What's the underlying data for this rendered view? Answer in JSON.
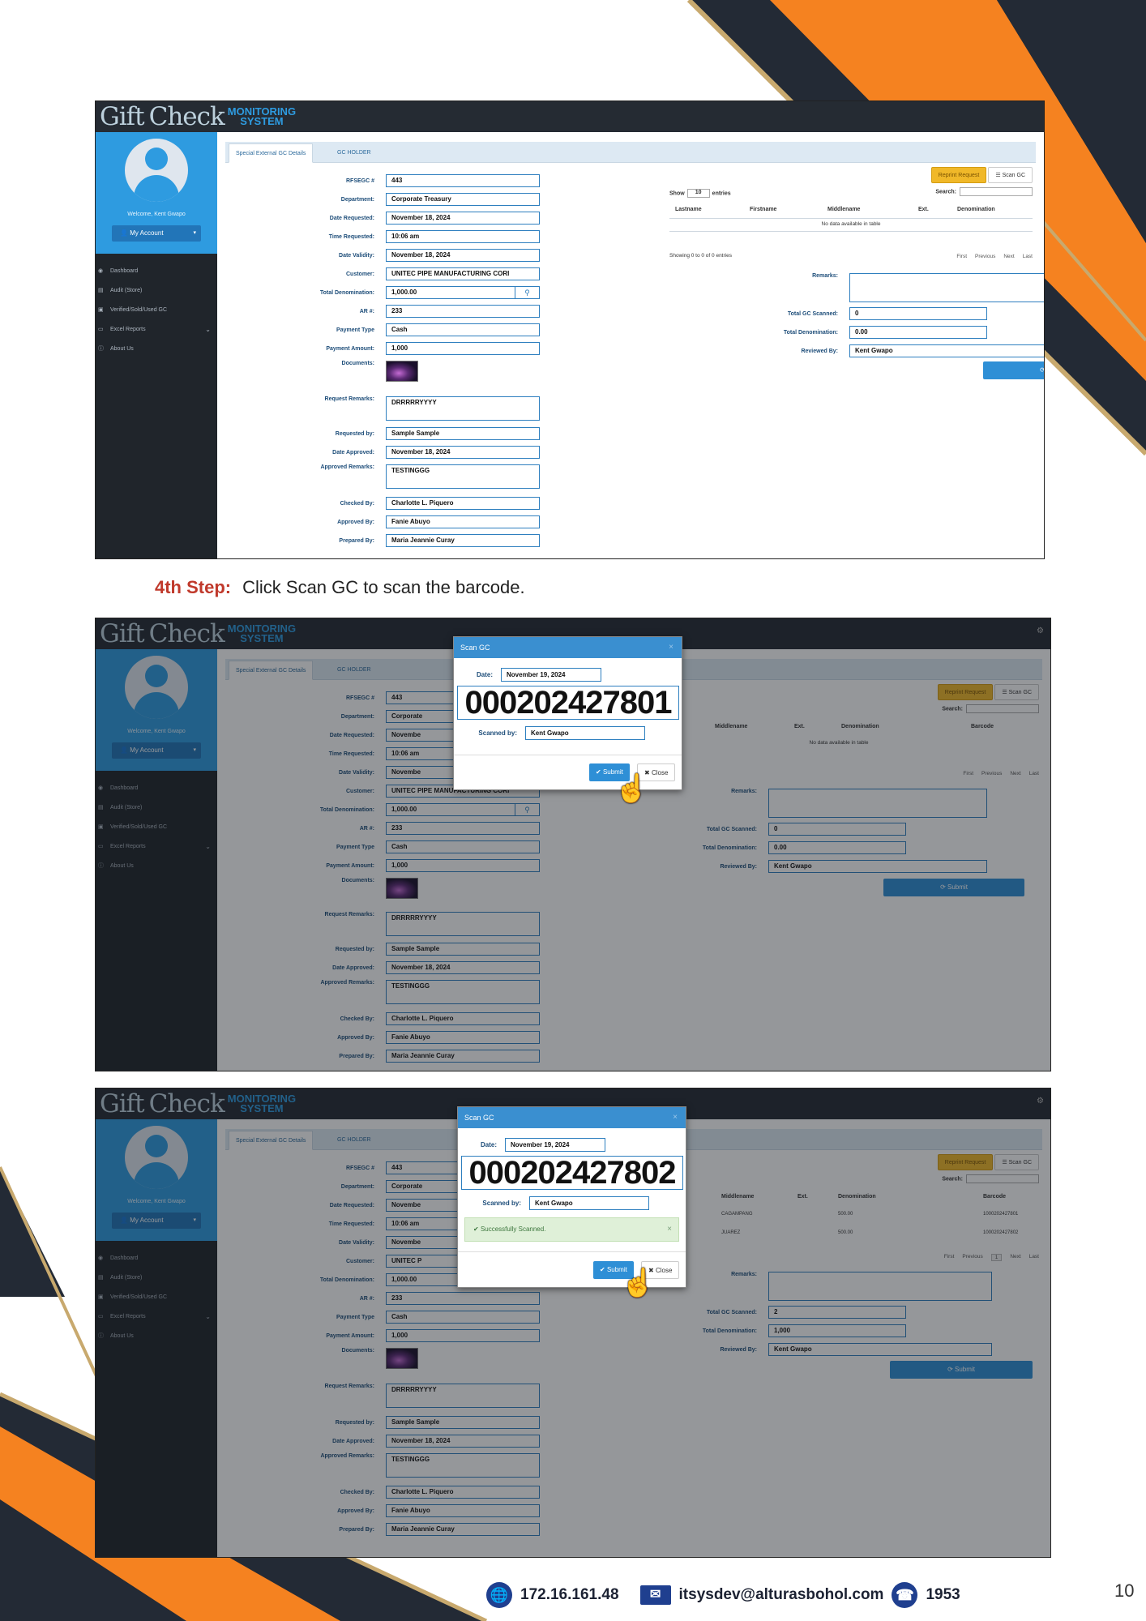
{
  "app": {
    "logo_gift": "Gift",
    "logo_check": "Check",
    "logo_monitoring": "MONITORING",
    "logo_system": "SYSTEM",
    "welcome": "Welcome, Kent Gwapo",
    "account_label": "My Account",
    "menu": [
      {
        "label": "Dashboard",
        "icon": "dashboard-icon"
      },
      {
        "label": "Audit (Store)",
        "icon": "list-icon"
      },
      {
        "label": "Verified/Sold/Used GC",
        "icon": "file-icon"
      },
      {
        "label": "Excel Reports",
        "icon": "monitor-icon"
      },
      {
        "label": "About Us",
        "icon": "info-icon"
      }
    ],
    "tabs": [
      "Special External GC Details",
      "GC HOLDER"
    ]
  },
  "form_labels": {
    "rfsegc": "RFSEGC #",
    "department": "Department:",
    "date_requested": "Date Requested:",
    "time_requested": "Time Requested:",
    "date_validity": "Date Validity:",
    "customer": "Customer:",
    "total_denomination": "Total Denomination:",
    "ar": "AR #:",
    "payment_type": "Payment Type",
    "payment_amount": "Payment Amount:",
    "documents": "Documents:",
    "request_remarks": "Request Remarks:",
    "requested_by": "Requested by:",
    "date_approved": "Date Approved:",
    "approved_remarks": "Approved Remarks:",
    "checked_by": "Checked By:",
    "approved_by": "Approved By:",
    "prepared_by": "Prepared By:"
  },
  "form_values": {
    "rfsegc": "443",
    "department": "Corporate Treasury",
    "department_short": "Corporate",
    "date_requested": "November 18, 2024",
    "date_requested_short": "Novembe",
    "time_requested": "10:06 am",
    "date_validity": "November 18, 2024",
    "date_validity_short": "Novembe",
    "customer": "UNITEC PIPE MANUFACTURING CORI",
    "customer_short": "UNITEC P",
    "total_denomination": "1,000.00",
    "ar": "233",
    "payment_type": "Cash",
    "payment_amount": "1,000",
    "request_remarks": "DRRRRRYYYY",
    "requested_by": "Sample Sample",
    "date_approved": "November 18, 2024",
    "approved_remarks": "TESTINGGG",
    "checked_by": "Charlotte L. Piquero",
    "approved_by": "Fanie Abuyo",
    "prepared_by": "Maria Jeannie Curay"
  },
  "right_panel": {
    "reprint_label": "Reprint Request",
    "scan_label": "Scan GC",
    "show_label": "Show",
    "show_value": "10",
    "entries_label": "entries",
    "search_label": "Search:",
    "columns": [
      "Lastname",
      "Firstname",
      "Middlename",
      "Ext.",
      "Denomination",
      "Barcode"
    ],
    "no_data": "No data available in table",
    "showing": "Showing 0 to 0 of 0 entries",
    "pager": [
      "First",
      "Previous",
      "Next",
      "Last"
    ],
    "pager_page": "1",
    "remarks_label": "Remarks:",
    "total_scanned_label": "Total GC Scanned:",
    "total_denom_label": "Total Denomination:",
    "reviewed_label": "Reviewed By:",
    "submit_label": "Submit",
    "shot1": {
      "total_scanned": "0",
      "total_denom": "0.00",
      "reviewed": "Kent Gwapo"
    },
    "shot3": {
      "total_scanned": "2",
      "total_denom": "1,000",
      "reviewed": "Kent Gwapo",
      "rows": [
        {
          "middlename": "CAGAMPANG",
          "denomination": "500.00",
          "barcode": "1000202427801"
        },
        {
          "middlename": "JUAREZ",
          "denomination": "500.00",
          "barcode": "1000202427802"
        }
      ]
    }
  },
  "step": {
    "label": "4th Step:",
    "text": "Click Scan GC to scan the barcode."
  },
  "modal": {
    "title": "Scan GC",
    "date_label": "Date:",
    "date_value": "November 19, 2024",
    "scanned_label": "Scanned by:",
    "scanned_value": "Kent Gwapo",
    "barcode_1": "000202427801",
    "barcode_2": "000202427802",
    "success": "Successfully Scanned.",
    "submit_label": "Submit",
    "close_label": "Close"
  },
  "footer": {
    "ip": "172.16.161.48",
    "email": "itsysdev@alturasbohol.com",
    "phone": "1953",
    "page_number": "10"
  },
  "colors": {
    "orange": "#f58220",
    "navy": "#232a35",
    "gold": "#c8a96e",
    "primary": "#2e9be0"
  }
}
